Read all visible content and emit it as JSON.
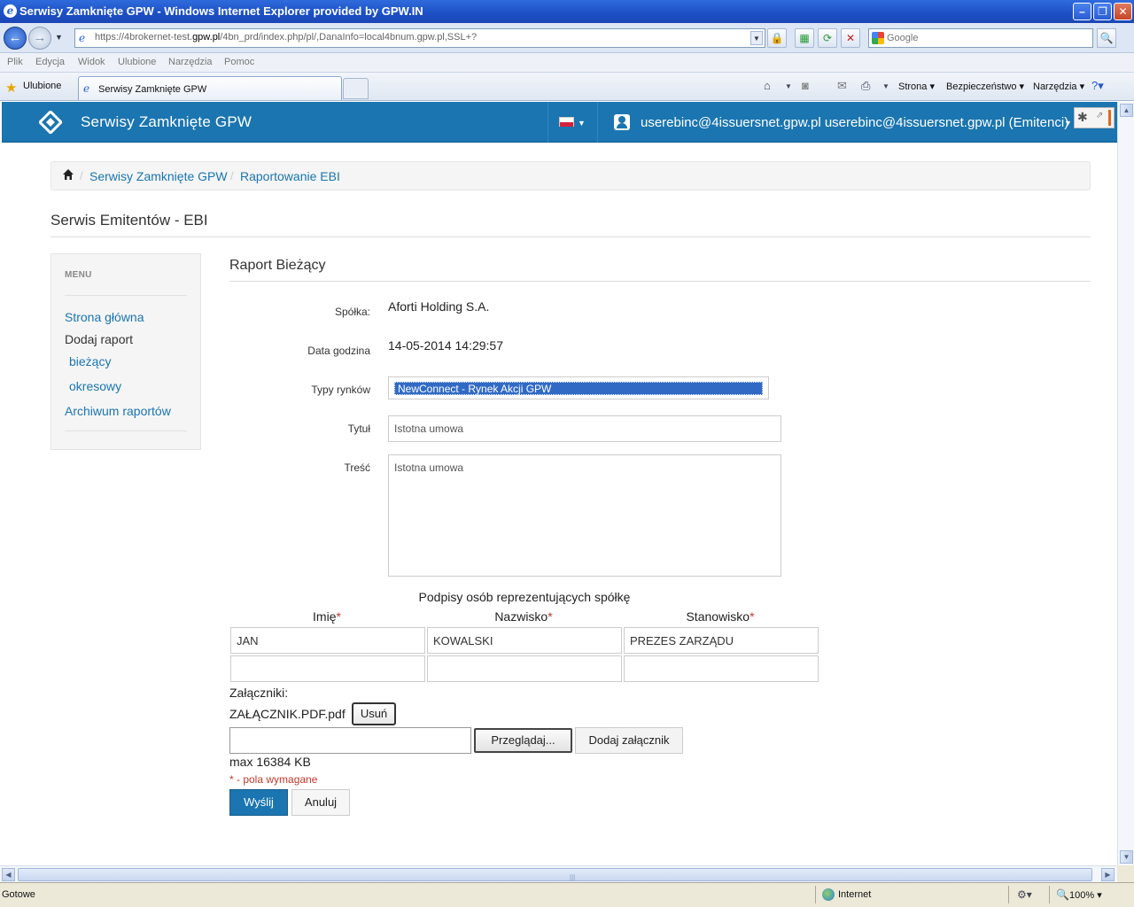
{
  "window": {
    "title": "Serwisy Zamknięte GPW - Windows Internet Explorer provided by GPW.IN",
    "url_prefix": "https://4brokernet-test.",
    "url_domain": "gpw.pl",
    "url_rest": "/4bn_prd/index.php/pl/,DanaInfo=local4bnum.gpw.pl,SSL+?",
    "search_placeholder": "Google"
  },
  "menu": [
    "Plik",
    "Edycja",
    "Widok",
    "Ulubione",
    "Narzędzia",
    "Pomoc"
  ],
  "favorites_label": "Ulubione",
  "tab_title": "Serwisy Zamknięte GPW",
  "commands": {
    "page": "Strona",
    "security": "Bezpieczeństwo",
    "tools": "Narzędzia"
  },
  "navbar": {
    "brand": "Serwisy Zamknięte GPW",
    "user": "userebinc@4issuersnet.gpw.pl userebinc@4issuersnet.gpw.pl (Emitenci)"
  },
  "breadcrumb": [
    "Serwisy Zamknięte GPW",
    "Raportowanie EBI"
  ],
  "page_title": "Serwis Emitentów - EBI",
  "sidebar": {
    "heading": "MENU",
    "items": [
      "Strona główna",
      "Dodaj raport",
      "bieżący",
      "okresowy",
      "Archiwum raportów"
    ]
  },
  "form": {
    "title": "Raport Bieżący",
    "company_label": "Spółka:",
    "company_value": "Aforti Holding S.A.",
    "date_label": "Data godzina",
    "date_value": "14-05-2014 14:29:57",
    "market_label": "Typy rynków",
    "market_value": "NewConnect - Rynek Akcji GPW",
    "title_label": "Tytuł",
    "title_value": "Istotna umowa",
    "content_label": "Treść",
    "content_value": "Istotna umowa"
  },
  "signatures": {
    "heading": "Podpisy osób reprezentujących spółkę",
    "columns": [
      "Imię",
      "Nazwisko",
      "Stanowisko"
    ],
    "required_mark": "*",
    "rows": [
      [
        "JAN",
        "KOWALSKI",
        "PREZES ZARZĄDU"
      ],
      [
        "",
        "",
        ""
      ]
    ]
  },
  "attachments": {
    "label": "Załączniki:",
    "file_name": "ZAŁĄCZNIK.PDF.pdf",
    "remove_label": "Usuń",
    "browse_label": "Przeglądaj...",
    "add_label": "Dodaj załącznik",
    "max_size": "max 16384 KB"
  },
  "required_note": "* - pola wymagane",
  "buttons": {
    "send": "Wyślij",
    "cancel": "Anuluj"
  },
  "statusbar": {
    "status": "Gotowe",
    "zone": "Internet",
    "zoom": "100%"
  },
  "colors": {
    "brand_blue": "#1a75b0",
    "required_red": "#c0392b",
    "selection": "#316ac5"
  }
}
